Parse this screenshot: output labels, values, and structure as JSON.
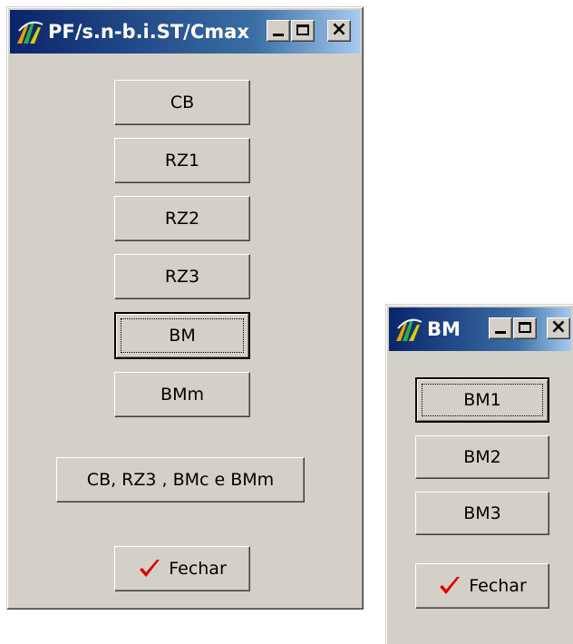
{
  "windows": [
    {
      "title": "PF/s.n-b.i.ST/Cmax",
      "buttons": [
        {
          "label": "CB"
        },
        {
          "label": "RZ1"
        },
        {
          "label": "RZ2"
        },
        {
          "label": "RZ3"
        },
        {
          "label": "BM"
        },
        {
          "label": "BMm"
        },
        {
          "label": "CB, RZ3 ,  BMc e BMm"
        },
        {
          "label": "Fechar"
        }
      ]
    },
    {
      "title": "BM",
      "buttons": [
        {
          "label": "BM1"
        },
        {
          "label": "BM2"
        },
        {
          "label": "BM3"
        },
        {
          "label": "Fechar"
        }
      ]
    }
  ],
  "colors": {
    "face": "#d4d0c8",
    "title_start": "#0a246a",
    "title_end": "#a6caf0",
    "check": "#e00000"
  },
  "icons": [
    "app-icon",
    "minimize-icon",
    "maximize-icon",
    "close-icon",
    "checkmark-icon"
  ]
}
